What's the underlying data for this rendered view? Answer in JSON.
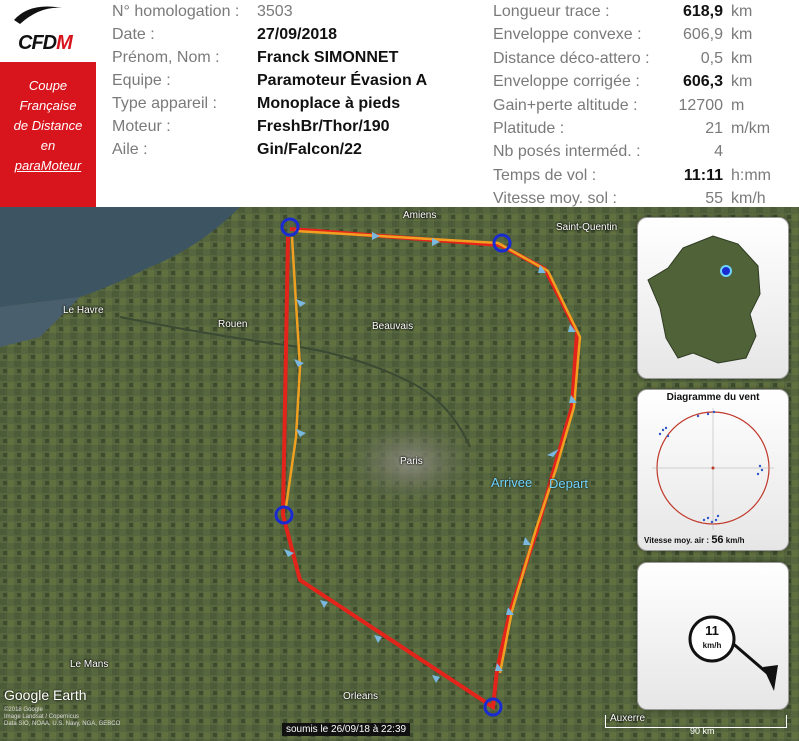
{
  "logo": {
    "text_c": "C",
    "text_rest": "FD",
    "text_m": "M"
  },
  "redbox": {
    "lines": [
      "Coupe",
      "Française",
      "de Distance",
      "en",
      "paraMoteur"
    ]
  },
  "flight_info": [
    {
      "label": "N° homologation :",
      "value": "3503",
      "bold": false
    },
    {
      "label": "Date :",
      "value": "27/09/2018",
      "bold": true
    },
    {
      "label": "Prénom, Nom :",
      "value": "Franck SIMONNET",
      "bold": true
    },
    {
      "label": "Equipe :",
      "value": "Paramoteur Évasion A",
      "bold": true
    },
    {
      "label": "Type appareil :",
      "value": "Monoplace à pieds",
      "bold": true
    },
    {
      "label": "Moteur :",
      "value": "FreshBr/Thor/190",
      "bold": true
    },
    {
      "label": "Aile :",
      "value": "Gin/Falcon/22",
      "bold": true
    }
  ],
  "stats": [
    {
      "label": "Longueur trace :",
      "value": "618,9",
      "unit": "km",
      "bold": true
    },
    {
      "label": "Enveloppe convexe :",
      "value": "606,9",
      "unit": "km",
      "bold": false
    },
    {
      "label": "Distance déco-attero :",
      "value": "0,5",
      "unit": "km",
      "bold": false
    },
    {
      "label": "Enveloppe corrigée :",
      "value": "606,3",
      "unit": "km",
      "bold": true
    },
    {
      "label": "Gain+perte altitude :",
      "value": "12700",
      "unit": "m",
      "bold": false
    },
    {
      "label": "Platitude :",
      "value": "21",
      "unit": "m/km",
      "bold": false
    },
    {
      "label": "Nb posés interméd. :",
      "value": "4",
      "unit": "",
      "bold": false
    },
    {
      "label": "Temps de vol :",
      "value": "11:11",
      "unit": "h:mm",
      "bold": true
    },
    {
      "label": "Vitesse moy. sol :",
      "value": "55",
      "unit": "km/h",
      "bold": false
    }
  ],
  "map": {
    "cities": [
      "Amiens",
      "Saint-Quentin",
      "Le Havre",
      "Rouen",
      "Beauvais",
      "Paris",
      "Le Mans",
      "Orleans",
      "Auxerre"
    ],
    "arrivee": "Arrivee",
    "depart": "Depart",
    "google_earth": "Google Earth",
    "copyright": "©2018 Google\nImage Landsat / Copernicus\nData SIO, NOAA, U.S. Navy, NGA, GEBCO",
    "submitted": "soumis le 26/09/18 à 22:39",
    "scale": "90 km"
  },
  "wind": {
    "title": "Diagramme du vent",
    "foot_label": "Vitesse moy. air :",
    "foot_value": "56",
    "foot_unit": "km/h"
  },
  "windspeed": {
    "value": "11",
    "unit": "km/h"
  },
  "colors": {
    "red": "#d8151c",
    "track_red": "#e3241b",
    "track_orange": "#f0a020",
    "marker_blue": "#1a2bd0"
  }
}
